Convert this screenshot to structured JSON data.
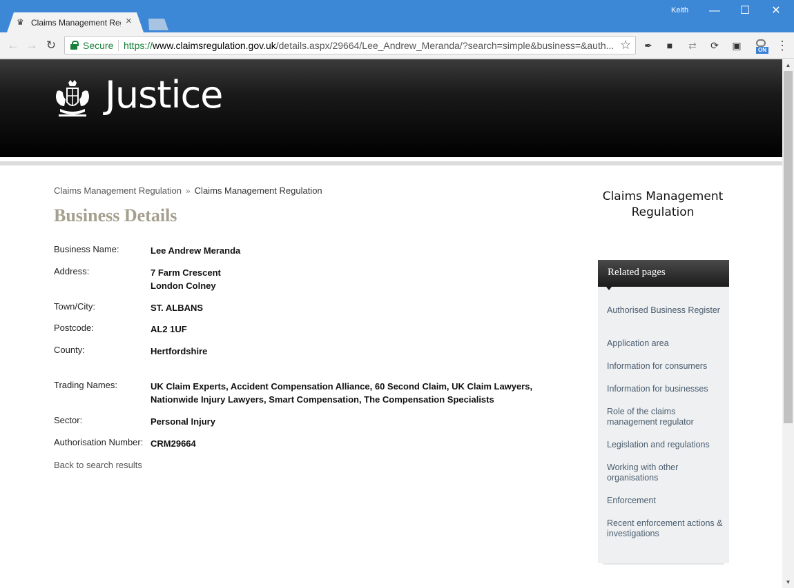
{
  "browser": {
    "tab_title": "Claims Management Regulation",
    "user": "Keith",
    "omnibox": {
      "secure_label": "Secure",
      "url_protocol": "https://",
      "url_host": "www.claimsregulation.gov.uk",
      "url_path": "/details.aspx/29664/Lee_Andrew_Meranda/?search=simple&business=&auth..."
    }
  },
  "site": {
    "brand": "Justice",
    "sidebar_logo": "Claims Management Regulation"
  },
  "breadcrumb": {
    "items": [
      "Claims Management Regulation",
      "Claims Management Regulation"
    ],
    "separator": "»"
  },
  "page": {
    "title": "Business Details",
    "fields": {
      "business_name": {
        "label": "Business Name:",
        "value": "Lee Andrew Meranda"
      },
      "address": {
        "label": "Address:",
        "value_lines": [
          "7 Farm Crescent",
          "London Colney"
        ]
      },
      "town": {
        "label": "Town/City:",
        "value": "ST. ALBANS"
      },
      "postcode": {
        "label": "Postcode:",
        "value": "AL2 1UF"
      },
      "county": {
        "label": "County:",
        "value": "Hertfordshire"
      },
      "trading_names": {
        "label": "Trading Names:",
        "value_lines": [
          "UK Claim Experts, Accident Compensation Alliance, 60 Second Claim, UK Claim Lawyers,",
          "Nationwide Injury Lawyers, Smart Compensation, The Compensation Specialists"
        ]
      },
      "sector": {
        "label": "Sector:",
        "value": "Personal Injury"
      },
      "authorisation": {
        "label": "Authorisation Number:",
        "value": "CRM29664"
      }
    },
    "back_link": "Back to search results"
  },
  "related": {
    "heading": "Related pages",
    "items": [
      "Authorised Business Register",
      "Application area",
      "Information for consumers",
      "Information for businesses",
      "Role of the claims management regulator",
      "Legislation and regulations",
      "Working with other organisations",
      "Enforcement",
      "Recent enforcement actions & investigations"
    ]
  },
  "colors": {
    "title_bar": "#3c87d6",
    "secure_green": "#188038",
    "page_title": "#a59f8e",
    "related_link": "#4b5d6e"
  }
}
